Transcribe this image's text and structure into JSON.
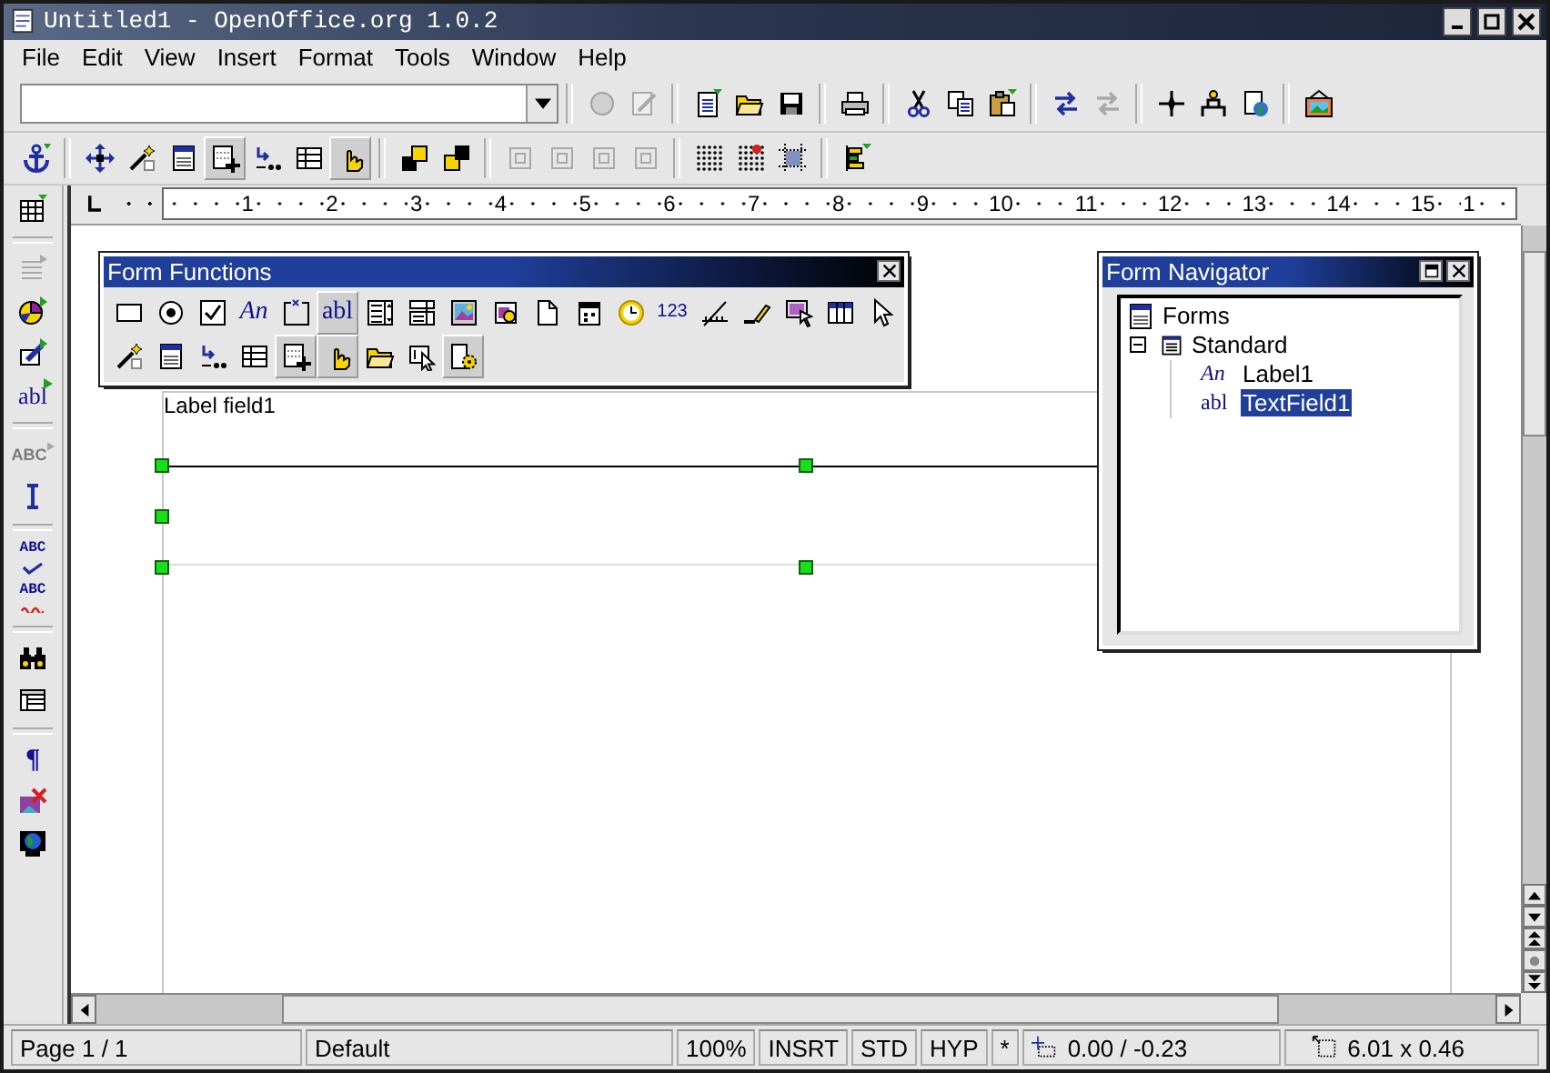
{
  "window": {
    "title": "Untitled1 - OpenOffice.org 1.0.2"
  },
  "menu": [
    {
      "label": "File"
    },
    {
      "label": "Edit"
    },
    {
      "label": "View"
    },
    {
      "label": "Insert"
    },
    {
      "label": "Format"
    },
    {
      "label": "Tools"
    },
    {
      "label": "Window"
    },
    {
      "label": "Help"
    }
  ],
  "toolbar_1": [
    {
      "kind": "button",
      "disabled": true
    },
    {
      "kind": "button",
      "disabled": true
    },
    {
      "kind": "separator"
    },
    {
      "kind": "button",
      "disabled": false
    },
    {
      "kind": "button",
      "disabled": false
    },
    {
      "kind": "button",
      "disabled": false
    },
    {
      "kind": "separator"
    },
    {
      "kind": "button",
      "disabled": false
    },
    {
      "kind": "separator"
    },
    {
      "kind": "button",
      "disabled": false
    },
    {
      "kind": "button",
      "disabled": false
    },
    {
      "kind": "button",
      "disabled": false
    },
    {
      "kind": "separator"
    },
    {
      "kind": "button",
      "disabled": false
    },
    {
      "kind": "button",
      "disabled": true
    },
    {
      "kind": "separator"
    },
    {
      "kind": "button",
      "disabled": false
    },
    {
      "kind": "button",
      "disabled": false
    },
    {
      "kind": "button",
      "disabled": false
    },
    {
      "kind": "separator"
    },
    {
      "kind": "button",
      "disabled": false
    }
  ],
  "toolbar_2": [
    {
      "kind": "button",
      "disabled": false,
      "selected": false
    },
    {
      "kind": "separator"
    },
    {
      "kind": "button",
      "disabled": false,
      "selected": false
    },
    {
      "kind": "button",
      "disabled": false,
      "selected": false
    },
    {
      "kind": "button",
      "disabled": false,
      "selected": false
    },
    {
      "kind": "button",
      "disabled": false,
      "selected": true
    },
    {
      "kind": "button",
      "disabled": false,
      "selected": false
    },
    {
      "kind": "button",
      "disabled": false,
      "selected": false
    },
    {
      "kind": "button",
      "disabled": false,
      "selected": true
    },
    {
      "kind": "separator"
    },
    {
      "kind": "button",
      "disabled": false,
      "selected": false
    },
    {
      "kind": "button",
      "disabled": false,
      "selected": false
    },
    {
      "kind": "separator"
    },
    {
      "kind": "button",
      "disabled": true,
      "selected": false
    },
    {
      "kind": "button",
      "disabled": true,
      "selected": false
    },
    {
      "kind": "button",
      "disabled": true,
      "selected": false
    },
    {
      "kind": "button",
      "disabled": true,
      "selected": false
    },
    {
      "kind": "separator"
    },
    {
      "kind": "button",
      "disabled": false,
      "selected": false
    },
    {
      "kind": "button",
      "disabled": false,
      "selected": false
    },
    {
      "kind": "button",
      "disabled": false,
      "selected": false
    },
    {
      "kind": "separator"
    },
    {
      "kind": "button",
      "disabled": false,
      "selected": false
    }
  ],
  "side_toolbar": [
    {
      "kind": "button",
      "disabled": false
    },
    {
      "kind": "separator"
    },
    {
      "kind": "button",
      "disabled": true
    },
    {
      "kind": "button",
      "disabled": false
    },
    {
      "kind": "button",
      "disabled": false
    },
    {
      "kind": "text",
      "label": "abl",
      "disabled": false
    },
    {
      "kind": "separator"
    },
    {
      "kind": "text",
      "label": "ABC",
      "disabled": true
    },
    {
      "kind": "button",
      "disabled": false
    },
    {
      "kind": "separator"
    },
    {
      "kind": "text",
      "label": "ABC",
      "disabled": false
    },
    {
      "kind": "text",
      "label": "ABC",
      "disabled": false
    },
    {
      "kind": "separator"
    },
    {
      "kind": "button",
      "disabled": false
    },
    {
      "kind": "button",
      "disabled": false
    },
    {
      "kind": "separator"
    },
    {
      "kind": "text",
      "label": "¶",
      "disabled": false
    },
    {
      "kind": "button",
      "disabled": false
    },
    {
      "kind": "button",
      "disabled": false
    }
  ],
  "ruler": {
    "labels": [
      "1",
      "2",
      "3",
      "4",
      "5",
      "6",
      "7",
      "8",
      "9",
      "10",
      "11",
      "12",
      "13",
      "14",
      "15",
      "1"
    ]
  },
  "document": {
    "label_field": "Label field1"
  },
  "form_functions": {
    "title": "Form Functions",
    "rows": [
      [
        {
          "kind": "button",
          "selected": false
        },
        {
          "kind": "button",
          "selected": false
        },
        {
          "kind": "button",
          "selected": false
        },
        {
          "kind": "text",
          "label": "An",
          "selected": false
        },
        {
          "kind": "button",
          "selected": false
        },
        {
          "kind": "text",
          "label": "abl",
          "selected": true
        },
        {
          "kind": "button",
          "selected": false
        },
        {
          "kind": "button",
          "selected": false
        },
        {
          "kind": "button",
          "selected": false
        },
        {
          "kind": "button",
          "selected": false
        },
        {
          "kind": "button",
          "selected": false
        },
        {
          "kind": "button",
          "selected": false
        },
        {
          "kind": "button",
          "selected": false
        },
        {
          "kind": "text",
          "label": "123",
          "selected": false
        },
        {
          "kind": "button",
          "selected": false
        },
        {
          "kind": "button",
          "selected": false
        },
        {
          "kind": "button",
          "selected": false
        },
        {
          "kind": "button",
          "selected": false
        },
        {
          "kind": "button",
          "selected": false
        }
      ],
      [
        {
          "kind": "button",
          "selected": false
        },
        {
          "kind": "button",
          "selected": false
        },
        {
          "kind": "button",
          "selected": false
        },
        {
          "kind": "button",
          "selected": false
        },
        {
          "kind": "button",
          "selected": true
        },
        {
          "kind": "button",
          "selected": true
        },
        {
          "kind": "button",
          "selected": false
        },
        {
          "kind": "button",
          "selected": false
        },
        {
          "kind": "button",
          "selected": true
        }
      ]
    ]
  },
  "form_navigator": {
    "title": "Form Navigator",
    "tree": [
      {
        "label": "Forms",
        "kind": "root",
        "selected": false,
        "children": [
          {
            "label": "Standard",
            "kind": "form",
            "expanded": true,
            "selected": false,
            "children": [
              {
                "label": "Label1",
                "kind": "control",
                "glyph": "An",
                "selected": false
              },
              {
                "label": "TextField1",
                "kind": "control",
                "glyph": "abl",
                "selected": true
              }
            ]
          }
        ]
      }
    ]
  },
  "status_bar": {
    "page": "Page 1 / 1",
    "style": "Default",
    "zoom": "100%",
    "insert_mode": "INSRT",
    "selection_mode": "STD",
    "hyperlink_mode": "HYP",
    "modified": "*",
    "position": "0.00 / -0.23",
    "size": "6.01 x 0.46"
  }
}
